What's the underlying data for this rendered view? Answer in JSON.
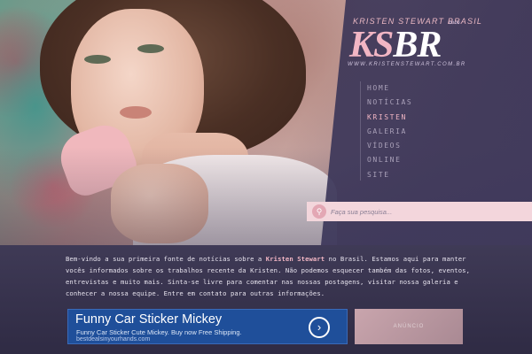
{
  "site": {
    "tagline": "KRISTEN STEWART BRASIL",
    "logo_ks": "KS",
    "logo_br": "BR",
    "url": "WWW.KRISTENSTEWART.COM.BR"
  },
  "nav": {
    "items": [
      {
        "label": "HOME",
        "active": false
      },
      {
        "label": "NOTÍCIAS",
        "active": false
      },
      {
        "label": "KRISTEN",
        "active": true
      },
      {
        "label": "GALERIA",
        "active": false
      },
      {
        "label": "VÍDEOS",
        "active": false
      },
      {
        "label": "ONLINE",
        "active": false
      },
      {
        "label": "SITE",
        "active": false
      }
    ]
  },
  "search": {
    "placeholder": "Faça sua pesquisa..."
  },
  "intro": {
    "part1": "Bem-vindo a sua primeira fonte de notícias sobre a ",
    "highlight": "Kristen Stewart",
    "part2": " no Brasil. Estamos aqui para manter vocês informados sobre os trabalhos recente da Kristen. Não podemos esquecer também das fotos, eventos, entrevistas e muito mais. Sinta-se livre para comentar nas nossas postagens, visitar nossa galeria e conhecer a nossa equipe. Entre em contato para outras informações."
  },
  "ad": {
    "title": "Funny Car Sticker Mickey",
    "description": "Funny Car Sticker Cute Mickey. Buy now Free Shipping.",
    "domain": "bestdealsinyourhands.com",
    "arrow_icon": "chevron-right-icon"
  },
  "ad2": {
    "label": "ANÚNCIO"
  },
  "colors": {
    "accent_pink": "#f2b6c4",
    "panel": "#37325a",
    "ad_blue": "#1f4f9a"
  }
}
